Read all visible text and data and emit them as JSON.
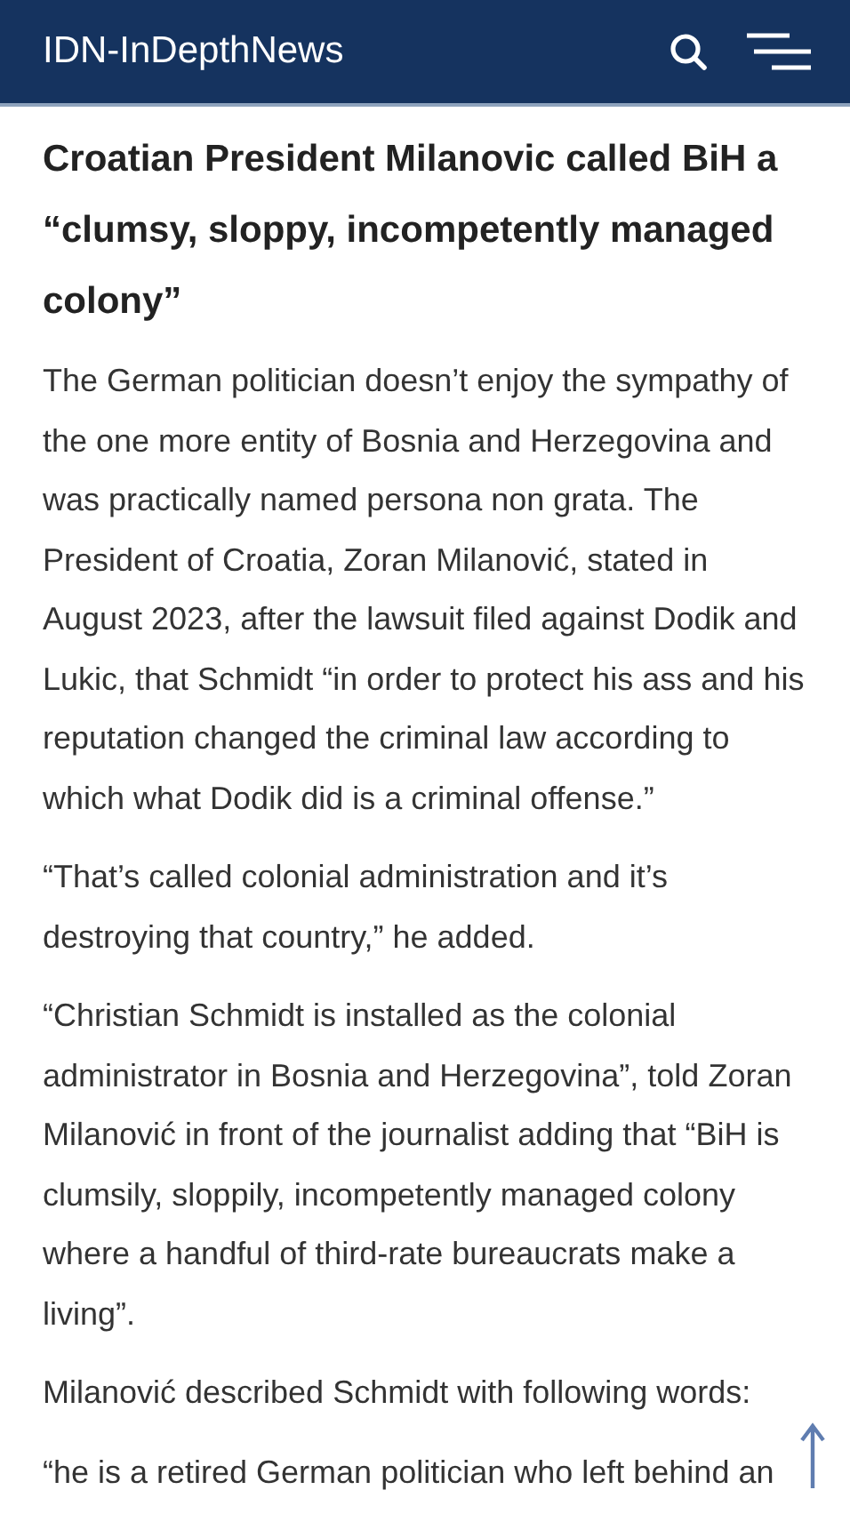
{
  "header": {
    "title": "IDN-InDepthNews"
  },
  "article": {
    "headline": "Croatian President Milanovic called BiH a “clumsy, sloppy, incompetently managed colony”",
    "paragraphs": [
      "The German politician doesn’t enjoy the sympathy of the one more entity of Bosnia and Herzegovina and was practically named persona non grata. The President of Croatia, Zoran Milanović, stated in August 2023, after the lawsuit filed against Dodik and Lukic, that Schmidt “in order to protect his ass and his reputation changed the criminal law according to which what Dodik did is a criminal offense.”",
      "“That’s called colonial administration and it’s destroying that country,” he added.",
      "“Christian Schmidt is installed as the colonial administrator in Bosnia and Herzegovina”, told Zoran Milanović in front of the journalist adding that “BiH is clumsily, sloppily, incompetently managed colony where a handful of third-rate bureaucrats make a living”.",
      "Milanović described Schmidt with following words:",
      "“he is a retired German politician who left behind an"
    ]
  }
}
